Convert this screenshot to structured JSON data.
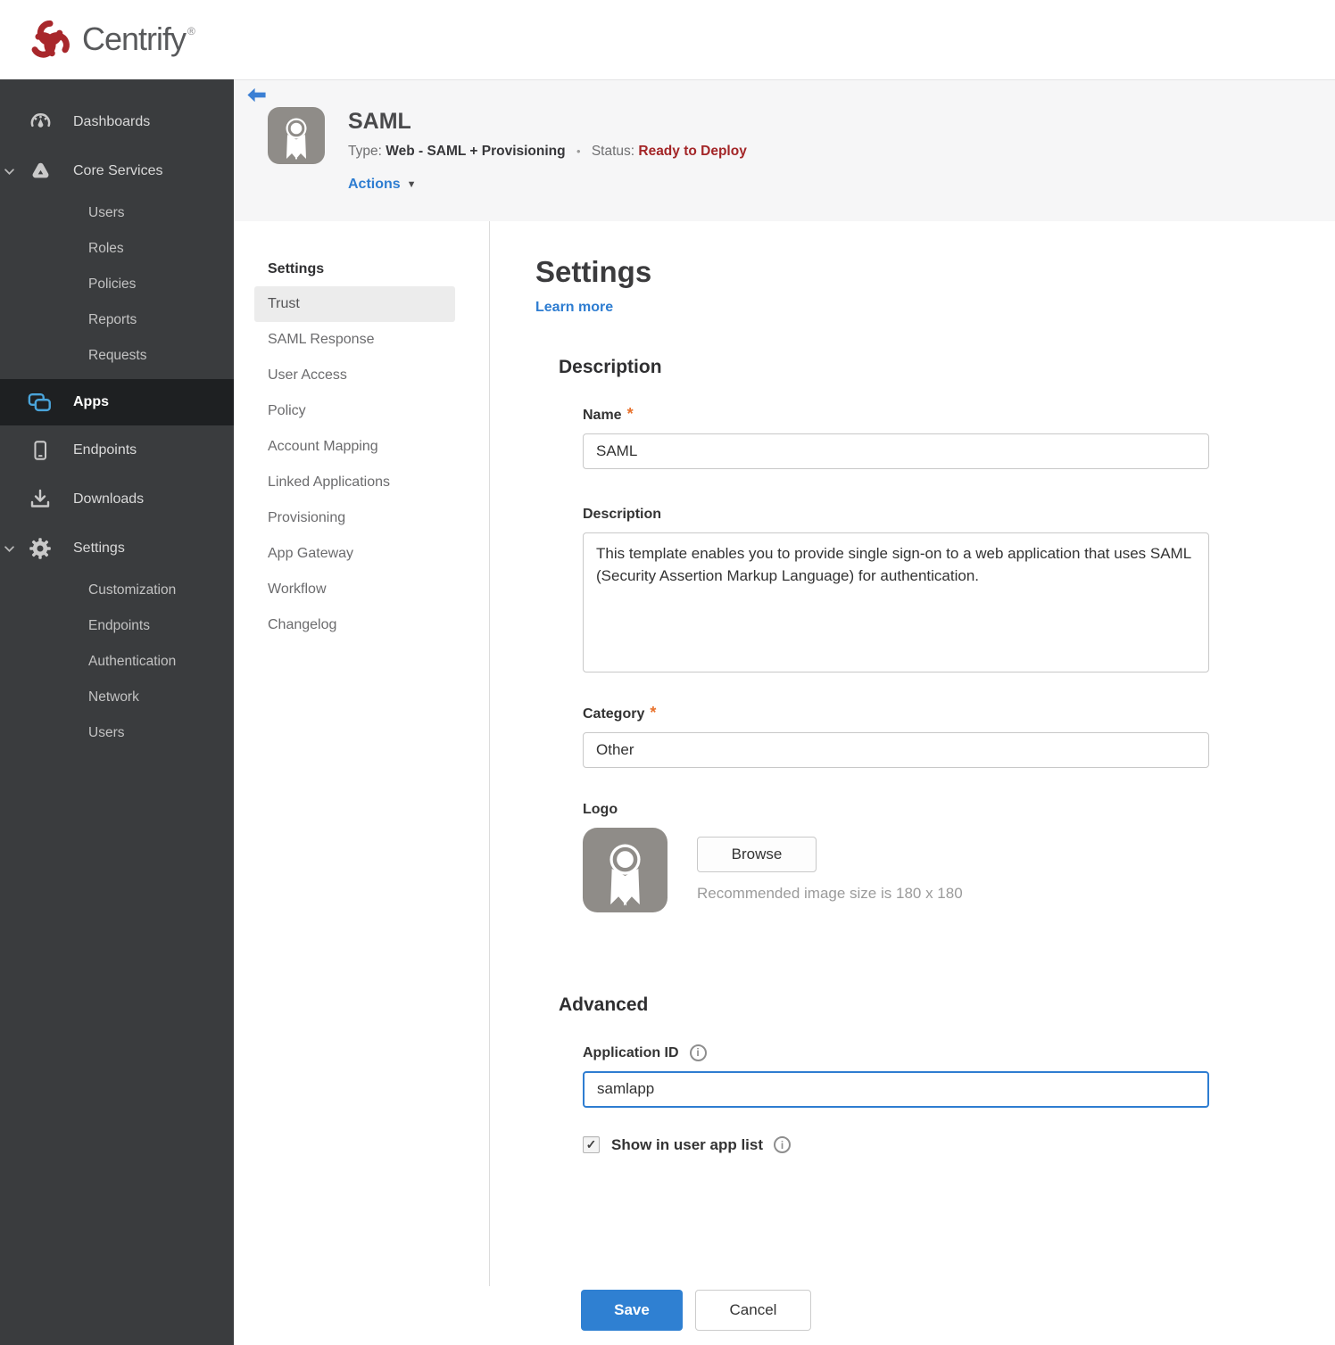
{
  "brand": {
    "name": "Centrify",
    "trademark": "®"
  },
  "colors": {
    "accent_blue": "#2e7dd1",
    "status_red": "#a32527",
    "apps_icon_blue": "#4aa4da",
    "required_orange": "#e8722d",
    "sidebar_bg": "#3a3c3e",
    "sidebar_active_bg": "#1e2022"
  },
  "markers": {
    "required": "*",
    "separator": "•",
    "caret": "▼",
    "checkmark": "✓",
    "info": "i"
  },
  "sidebar": {
    "items": [
      {
        "label": "Dashboards"
      },
      {
        "label": "Core Services",
        "expanded": true,
        "children": [
          "Users",
          "Roles",
          "Policies",
          "Reports",
          "Requests"
        ]
      },
      {
        "label": "Apps",
        "active": true
      },
      {
        "label": "Endpoints"
      },
      {
        "label": "Downloads"
      },
      {
        "label": "Settings",
        "expanded": true,
        "children": [
          "Customization",
          "Endpoints",
          "Authentication",
          "Network",
          "Users"
        ]
      }
    ]
  },
  "header": {
    "app_title": "SAML",
    "type_label": "Type:",
    "type_value": "Web - SAML + Provisioning",
    "status_label": "Status:",
    "status_value": "Ready to Deploy",
    "actions_label": "Actions"
  },
  "subnav": {
    "title": "Settings",
    "selected": "Trust",
    "items": [
      "Trust",
      "SAML Response",
      "User Access",
      "Policy",
      "Account Mapping",
      "Linked Applications",
      "Provisioning",
      "App Gateway",
      "Workflow",
      "Changelog"
    ]
  },
  "main": {
    "title": "Settings",
    "learn_more": "Learn more",
    "description_section": {
      "heading": "Description",
      "name_label": "Name",
      "name_value": "SAML",
      "description_label": "Description",
      "description_value": "This template enables you to provide single sign-on to a web application that uses SAML (Security Assertion Markup Language) for authentication.",
      "category_label": "Category",
      "category_value": "Other",
      "logo_label": "Logo",
      "browse_label": "Browse",
      "logo_hint": "Recommended image size is 180 x 180"
    },
    "advanced_section": {
      "heading": "Advanced",
      "app_id_label": "Application ID",
      "app_id_value": "samlapp",
      "show_in_app_list_label": "Show in user app list",
      "show_in_app_list_checked": true
    },
    "footer": {
      "save_label": "Save",
      "cancel_label": "Cancel"
    }
  }
}
